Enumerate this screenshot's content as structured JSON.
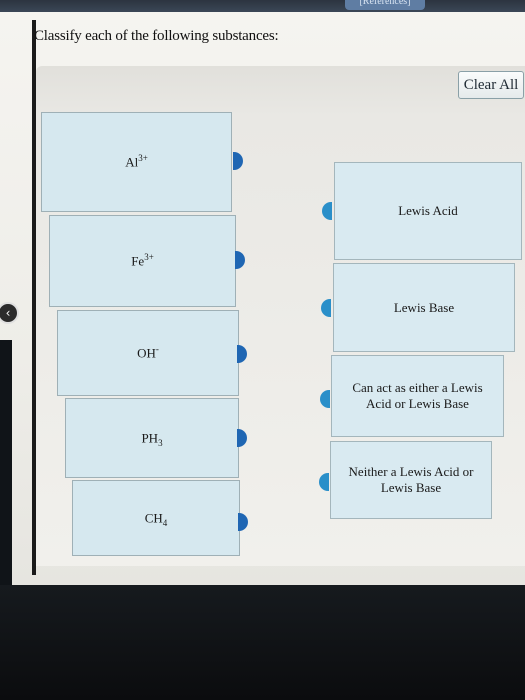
{
  "header": {
    "references_label": "[References]"
  },
  "question": "Classify each of the following substances:",
  "clear_all_label": "Clear All",
  "items": [
    {
      "base": "Al",
      "sup": "3+",
      "sub": ""
    },
    {
      "base": "Fe",
      "sup": "3+",
      "sub": ""
    },
    {
      "base": "OH",
      "sup": "-",
      "sub": ""
    },
    {
      "base": "PH",
      "sup": "",
      "sub": "3"
    },
    {
      "base": "CH",
      "sup": "",
      "sub": "4"
    }
  ],
  "targets": [
    {
      "label": "Lewis Acid"
    },
    {
      "label": "Lewis Base"
    },
    {
      "label": "Can act as either a Lewis Acid or Lewis Base"
    },
    {
      "label": "Neither a Lewis Acid or Lewis Base"
    }
  ],
  "colors": {
    "tab_dark": "#1f66b3",
    "tab_light": "#2a8fc9",
    "box_fill": "#d6e8ef"
  }
}
